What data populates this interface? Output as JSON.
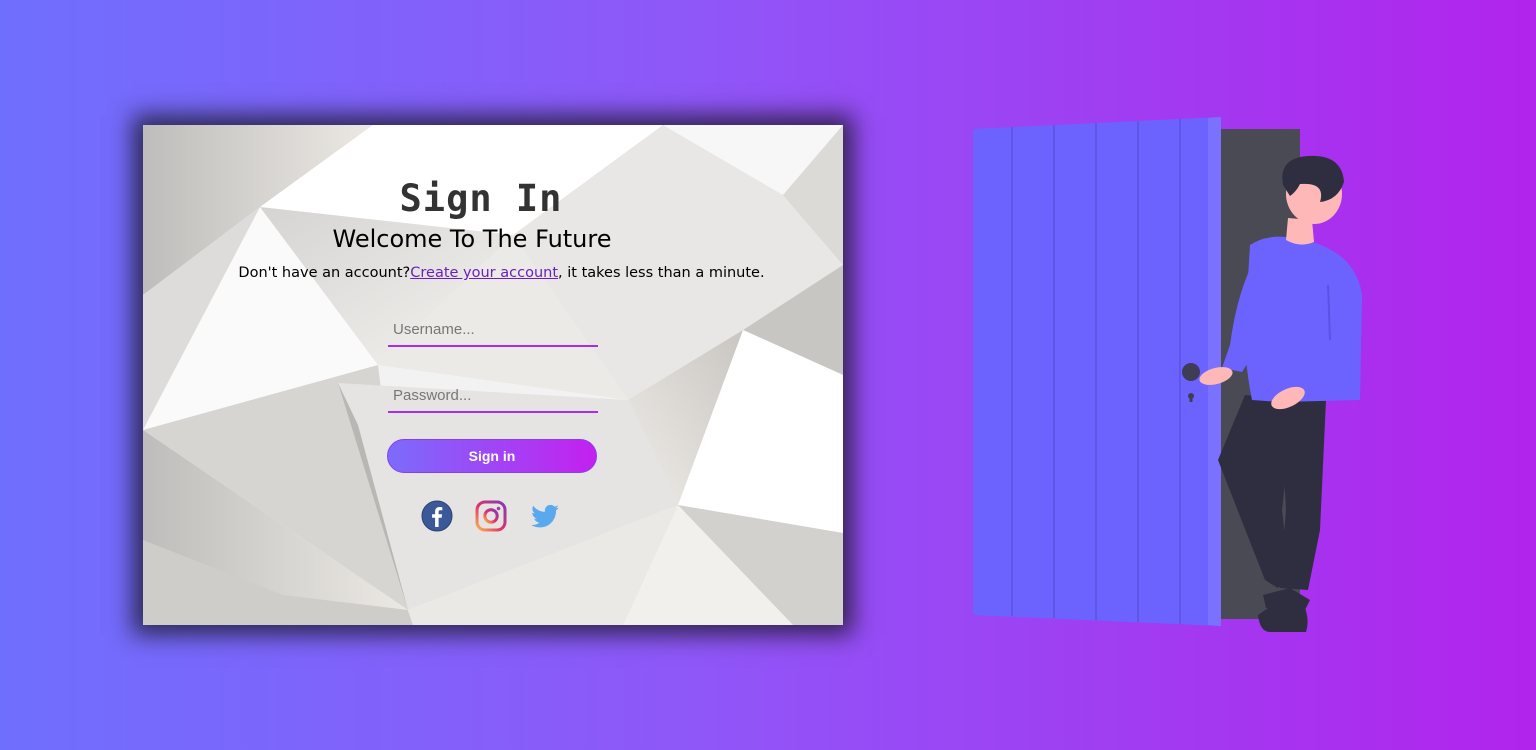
{
  "login": {
    "title": "Sign In",
    "subtitle": "Welcome To The Future",
    "signup_prefix": "Don't have an account?",
    "signup_link": "Create your account",
    "signup_suffix": ", it takes less than a minute.",
    "username_placeholder": "Username...",
    "password_placeholder": "Password...",
    "submit_label": "Sign in"
  },
  "socials": [
    {
      "name": "facebook",
      "icon": "facebook-icon",
      "color": "#3b5998"
    },
    {
      "name": "instagram",
      "icon": "instagram-icon",
      "color": "#c13584"
    },
    {
      "name": "twitter",
      "icon": "twitter-icon",
      "color": "#55acee"
    }
  ],
  "colors": {
    "bg_start": "#6f6ffd",
    "bg_end": "#b124ec",
    "accent": "#a52ef0",
    "door": "#6c63ff",
    "link": "#6a1fc0"
  }
}
